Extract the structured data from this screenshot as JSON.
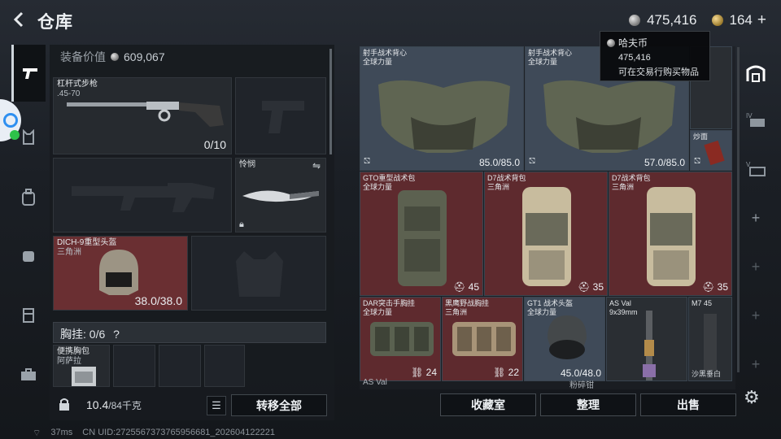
{
  "header": {
    "title": "仓库",
    "currency_silver": "475,416",
    "currency_gold": "164",
    "plus": "+"
  },
  "tooltip": {
    "title": "哈夫币",
    "amount": "475,416",
    "desc": "可在交易行购买物品"
  },
  "loadout": {
    "value_label": "装备价值",
    "value": "609,067",
    "primary": {
      "name": "杠杆式步枪",
      "caliber": ".45-70",
      "count": "0/10"
    },
    "melee": {
      "name": "怜悯"
    },
    "helmet": {
      "name": "DICH-9重型头盔",
      "region": "三角洲",
      "durability": "38.0/38.0"
    },
    "chest_rig": {
      "label": "胸挂: 0/6",
      "help": "?"
    },
    "pouch": {
      "name": "便携胸包",
      "sub": "阿萨拉"
    },
    "weight": "10.4",
    "weight_max": "/84千克",
    "transfer_label": "转移全部"
  },
  "storage": {
    "items": [
      {
        "name": "射手战术背心",
        "sub": "全球力量",
        "durability": "85.0/85.0"
      },
      {
        "name": "射手战术背心",
        "sub": "全球力量",
        "durability": "57.0/85.0"
      },
      {
        "name": "炒面"
      },
      {
        "name": "GTO重型战术包",
        "sub": "全球力量",
        "capacity": "45"
      },
      {
        "name": "D7战术背包",
        "sub": "三角洲",
        "capacity": "35"
      },
      {
        "name": "D7战术背包",
        "sub": "三角洲",
        "capacity": "35"
      },
      {
        "name": "DAR突击手胸挂",
        "sub": "全球力量",
        "capacity": "24"
      },
      {
        "name": "黑鹰野战胸挂",
        "sub": "三角洲",
        "capacity": "22"
      },
      {
        "name": "GT1 战术头盔",
        "sub": "全球力量",
        "durability": "45.0/48.0"
      },
      {
        "name": "AS Val",
        "sub": "9x39mm"
      },
      {
        "name": "M7 45"
      },
      {
        "name": "AS Val"
      },
      {
        "name": "粉碎钳"
      },
      {
        "name": "沙黑垂白"
      }
    ]
  },
  "actions": {
    "collection": "收藏室",
    "organize": "整理",
    "sell": "出售"
  },
  "status_bar": {
    "ping": "37ms",
    "uid": "CN UID:272556737376595668​1_202604122221"
  }
}
